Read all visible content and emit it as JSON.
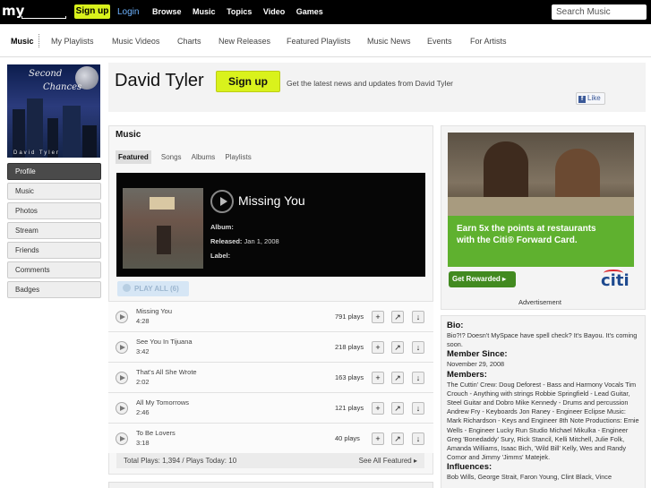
{
  "topbar": {
    "logo": "my",
    "signup": "Sign up",
    "login": "Login",
    "nav": [
      "Browse",
      "Music",
      "Topics",
      "Video",
      "Games"
    ],
    "search_placeholder": "Search Music"
  },
  "subnav": [
    "Music",
    "My Playlists",
    "Music Videos",
    "Charts",
    "New Releases",
    "Featured Playlists",
    "Music News",
    "Events",
    "For Artists"
  ],
  "cover": {
    "line1": "Second",
    "line2": "Chances",
    "footer": "David Tyler"
  },
  "leftnav": [
    "Profile",
    "Music",
    "Photos",
    "Stream",
    "Friends",
    "Comments",
    "Badges"
  ],
  "header": {
    "artist": "David Tyler",
    "signup": "Sign up",
    "news": "Get the latest news and updates from David Tyler",
    "like": "Like"
  },
  "music": {
    "title": "Music",
    "tabs": [
      "Featured",
      "Songs",
      "Albums",
      "Playlists"
    ],
    "featured": {
      "label": "",
      "song": "Missing You",
      "album_label": "Album:",
      "album": "",
      "released_label": "Released:",
      "released": "Jan 1, 2008",
      "label_label": "Label:"
    },
    "play_all": "PLAY ALL (6)",
    "tracks": [
      {
        "name": "Missing You",
        "duration": "4:28",
        "plays": "791 plays"
      },
      {
        "name": "See You In Tijuana",
        "duration": "3:42",
        "plays": "218 plays"
      },
      {
        "name": "That's All She Wrote",
        "duration": "2:02",
        "plays": "163 plays"
      },
      {
        "name": "All My Tomorrows",
        "duration": "2:46",
        "plays": "121 plays"
      },
      {
        "name": "To Be Lovers",
        "duration": "3:18",
        "plays": "40 plays"
      }
    ],
    "footer_left": "Total Plays: 1,394 / Plays Today: 10",
    "footer_right": "See All Featured ▸"
  },
  "ad": {
    "headline1": "Earn 5x the points at restaurants",
    "headline2": "with the Citi® Forward Card.",
    "button": "Get Rewarded ▸",
    "brand": "citi",
    "label": "Advertisement"
  },
  "bio": {
    "bio_title": "Bio:",
    "bio_text": "Bio?!? Doesn't MySpace have spell check? It's Bayou. It's coming soon.",
    "member_title": "Member Since:",
    "member_text": "November 29, 2008",
    "members_title": "Members:",
    "members_text": "The Cuttin' Crew: Doug Deforest - Bass and Harmony Vocals Tim Crouch - Anything with strings Robbie Springfield - Lead Guitar, Steel Guitar and Dobro Mike Kennedy - Drums and percussion Andrew Fry - Keyboards Jon Raney - Engineer Eclipse Music: Mark Richardson - Keys and Engineer 8th Note Productions: Ernie Wells - Engineer Lucky Run Studio Michael Mikulka - Engineer Greg 'Bonedaddy' Sury, Rick Stancil, Kelli Mitchell, Julie Folk, Amanda Williams, Isaac Bich, 'Wild Bill' Kelly, Wes and Randy Cornor and Jimmy 'Jimms' Matejek.",
    "influences_title": "Influences:",
    "influences_text": "Bob Wills, George Strait, Faron Young, Clint Black, Vince"
  }
}
